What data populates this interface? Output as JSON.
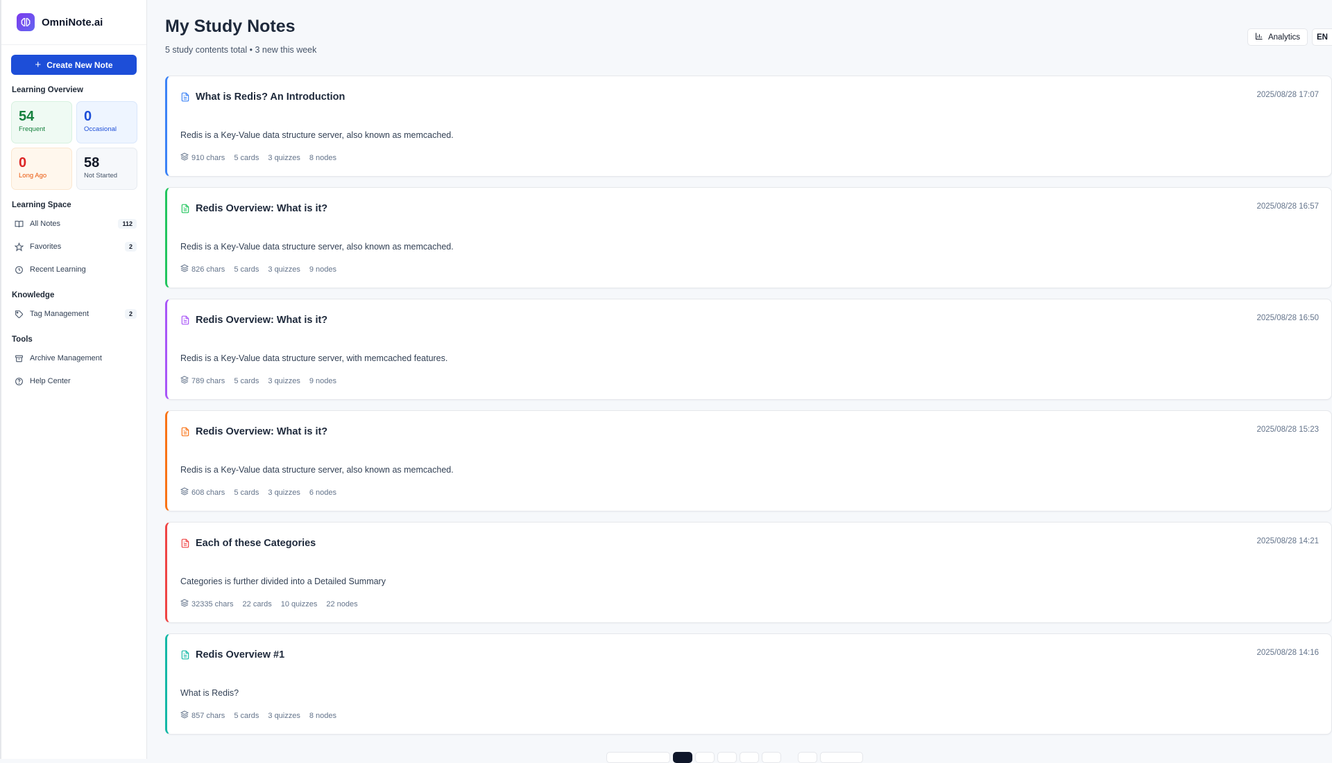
{
  "brand": {
    "name": "OmniNote.ai"
  },
  "sidebar": {
    "create_label": "Create New Note",
    "overview_title": "Learning Overview",
    "overview": [
      {
        "value": "54",
        "label": "Frequent"
      },
      {
        "value": "0",
        "label": "Occasional"
      },
      {
        "value": "0",
        "label": "Long Ago"
      },
      {
        "value": "58",
        "label": "Not Started"
      }
    ],
    "learning_space_title": "Learning Space",
    "learning_space": [
      {
        "label": "All Notes",
        "badge": "112"
      },
      {
        "label": "Favorites",
        "badge": "2"
      },
      {
        "label": "Recent Learning"
      }
    ],
    "knowledge_title": "Knowledge",
    "knowledge": [
      {
        "label": "Tag Management",
        "badge": "2"
      }
    ],
    "tools_title": "Tools",
    "tools": [
      {
        "label": "Archive Management"
      },
      {
        "label": "Help Center"
      }
    ]
  },
  "header": {
    "title": "My Study Notes",
    "subtitle": "5 study contents total • 3 new this week",
    "analytics_label": "Analytics",
    "lang_label": "EN"
  },
  "notes": [
    {
      "title": "What is Redis? An Introduction",
      "date": "2025/08/28 17:07",
      "desc": "Redis is a Key-Value data structure server, also known as memcached.",
      "chars": "910 chars",
      "cards": "5 cards",
      "quizzes": "3 quizzes",
      "nodes": "8 nodes",
      "color": "#3b82f6"
    },
    {
      "title": "Redis Overview: What is it?",
      "date": "2025/08/28 16:57",
      "desc": "Redis is a Key-Value data structure server, also known as memcached.",
      "chars": "826 chars",
      "cards": "5 cards",
      "quizzes": "3 quizzes",
      "nodes": "9 nodes",
      "color": "#22c55e"
    },
    {
      "title": "Redis Overview: What is it?",
      "date": "2025/08/28 16:50",
      "desc": "Redis is a Key-Value data structure server, with memcached features.",
      "chars": "789 chars",
      "cards": "5 cards",
      "quizzes": "3 quizzes",
      "nodes": "9 nodes",
      "color": "#a855f7"
    },
    {
      "title": "Redis Overview: What is it?",
      "date": "2025/08/28 15:23",
      "desc": "Redis is a Key-Value data structure server, also known as memcached.",
      "chars": "608 chars",
      "cards": "5 cards",
      "quizzes": "3 quizzes",
      "nodes": "6 nodes",
      "color": "#f97316"
    },
    {
      "title": "Each of these Categories",
      "date": "2025/08/28 14:21",
      "desc": "Categories is further divided into a Detailed Summary",
      "chars": "32335 chars",
      "cards": "22 cards",
      "quizzes": "10 quizzes",
      "nodes": "22 nodes",
      "color": "#ef4444"
    },
    {
      "title": "Redis Overview #1",
      "date": "2025/08/28 14:16",
      "desc": "What is Redis?",
      "chars": "857 chars",
      "cards": "5 cards",
      "quizzes": "3 quizzes",
      "nodes": "8 nodes",
      "color": "#14b8a6"
    }
  ]
}
